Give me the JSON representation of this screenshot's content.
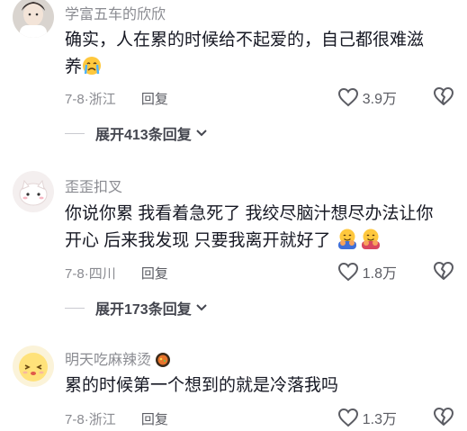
{
  "comments": [
    {
      "username": "学富五车的欣欣",
      "text_line1": "确实，人在累的时候给不起爱的，自己都很难滋",
      "text_line2": "养",
      "date": "7-8",
      "location": "浙江",
      "reply_label": "回复",
      "likes": "3.9万",
      "expand_label": "展开413条回复"
    },
    {
      "username": "歪歪扣叉",
      "text_line1": "你说你累 我看着急死了 我绞尽脑汁想尽办法让你",
      "text_line2": "开心 后来我发现 只要我离开就好了",
      "date": "7-8",
      "location": "四川",
      "reply_label": "回复",
      "likes": "1.8万",
      "expand_label": "展开173条回复"
    },
    {
      "username": "明天吃麻辣烫",
      "text_line1": "累的时候第一个想到的就是冷落我吗",
      "date": "7-8",
      "location": "浙江",
      "reply_label": "回复",
      "likes": "1.3万"
    }
  ],
  "icons": {
    "crying_emoji": "crying-emoji-icon",
    "hug_emoji": "hug-emoji-icon",
    "heart": "heart-outline-icon",
    "broken_heart": "broken-heart-icon",
    "chevron": "chevron-down-icon"
  },
  "colors": {
    "text_primary": "#161823",
    "text_secondary": "#8a8b91"
  }
}
